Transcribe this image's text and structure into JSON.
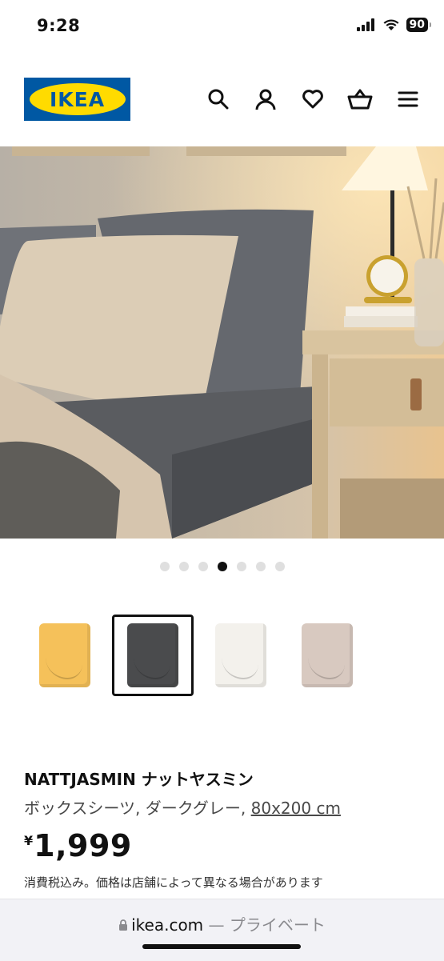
{
  "status_bar": {
    "time": "9:28",
    "battery": "90"
  },
  "header": {
    "logo_text": "IKEA",
    "icons": [
      "search-icon",
      "account-icon",
      "favorites-icon",
      "cart-icon",
      "menu-icon"
    ]
  },
  "gallery": {
    "dots_total": 7,
    "active_dot": 4
  },
  "swatches": [
    {
      "name": "yellow",
      "color": "#f5c15a",
      "selected": false
    },
    {
      "name": "dark-grey",
      "color": "#4a4b4d",
      "selected": true
    },
    {
      "name": "white",
      "color": "#f3f1ec",
      "selected": false
    },
    {
      "name": "beige",
      "color": "#d8c9c0",
      "selected": false
    }
  ],
  "product": {
    "name": "NATTJASMIN ナットヤスミン",
    "description": "ボックスシーツ, ダークグレー, ",
    "size": "80x200 cm",
    "currency": "¥",
    "price": "1,999",
    "tax_note": "消費税込み。価格は店舗によって異なる場合があります"
  },
  "browser": {
    "domain": "ikea.com",
    "separator": "—",
    "mode": "プライベート"
  },
  "colors": {
    "ikea_blue": "#0058a3",
    "ikea_yellow": "#ffdb00"
  }
}
